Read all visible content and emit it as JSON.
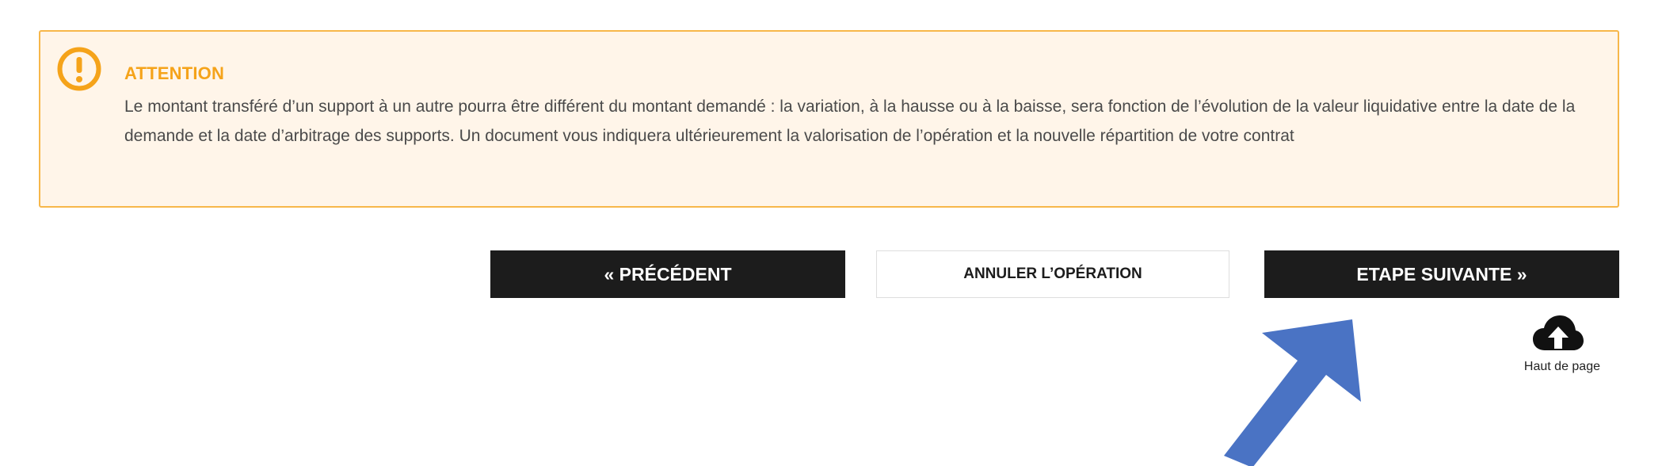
{
  "alert": {
    "icon": "exclamation-circle-icon",
    "title": "ATTENTION",
    "text": "Le montant transféré d’un support à un autre pourra être différent du montant demandé : la variation, à la hausse ou à la baisse, sera fonction de l’évolution de la valeur liquidative entre la date de la demande et la date d’arbitrage des supports. Un document vous indiquera ultérieurement la valorisation de l’opération et la nouvelle répartition de votre contrat",
    "accent_color": "#f5a31a",
    "background_color": "#fff5e9"
  },
  "actions": {
    "previous_label": "« PRÉCÉDENT",
    "cancel_label": "ANNULER L’OPÉRATION",
    "next_label": "ETAPE SUIVANTE »"
  },
  "back_to_top": {
    "icon": "cloud-upload-icon",
    "label": "Haut de page"
  },
  "annotation": {
    "icon": "pointer-arrow-icon",
    "color": "#4a73c4"
  }
}
